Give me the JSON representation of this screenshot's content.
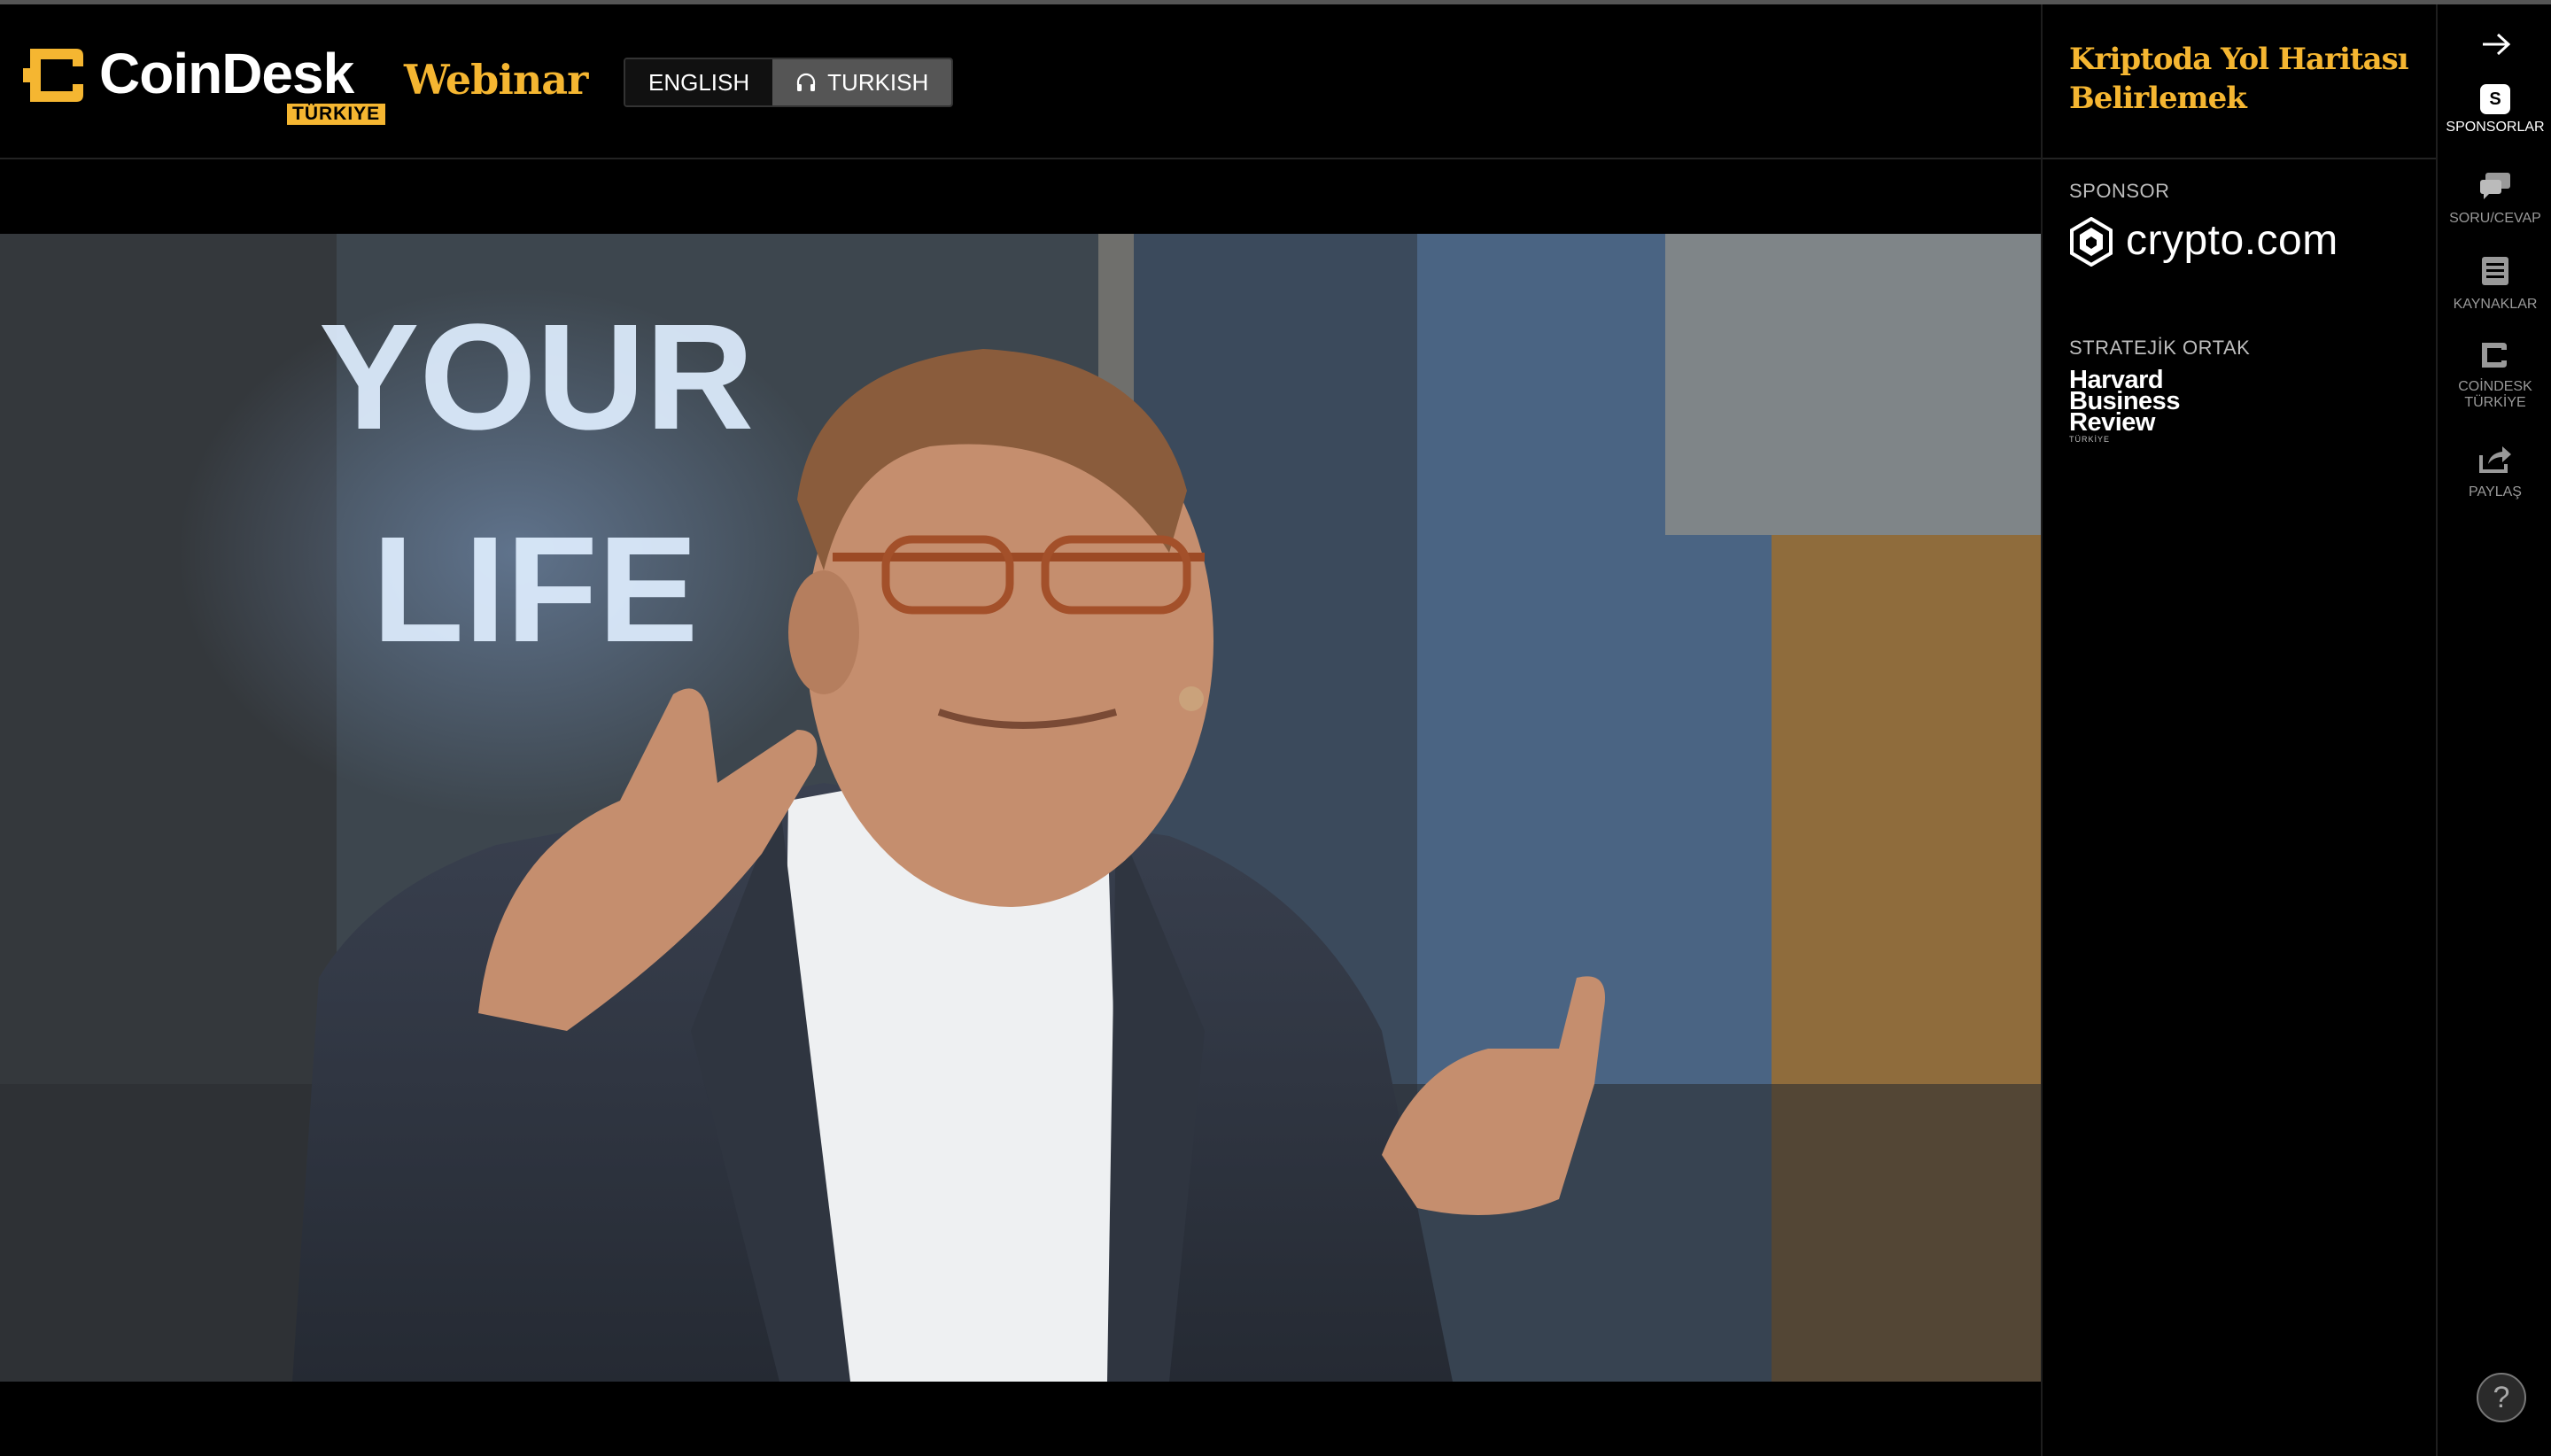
{
  "header": {
    "brand_name": "CoinDesk",
    "brand_sub": "TÜRKIYE",
    "product": "Webinar",
    "languages": [
      {
        "label": "ENGLISH",
        "selected": false
      },
      {
        "label": "TURKISH",
        "selected": true
      }
    ]
  },
  "video": {
    "sign_text_line1": "YOUR",
    "sign_text_line2": "LIFE"
  },
  "panel": {
    "event_title": "Kriptoda Yol Haritası Belirlemek",
    "sponsor_label": "SPONSOR",
    "sponsor_name": "crypto.com",
    "partner_label": "STRATEJİK ORTAK",
    "partner_lines": [
      "Harvard",
      "Business",
      "Review"
    ],
    "partner_sub": "TÜRKİYE"
  },
  "rail": {
    "items": [
      {
        "label": "SPONSORLAR",
        "icon": "sponsors-icon",
        "active": true
      },
      {
        "label": "SORU/CEVAP",
        "icon": "chat-icon",
        "active": false
      },
      {
        "label": "KAYNAKLAR",
        "icon": "resources-icon",
        "active": false
      },
      {
        "label": "COİNDESK TÜRKİYE",
        "icon": "coindesk-icon",
        "active": false
      },
      {
        "label": "PAYLAŞ",
        "icon": "share-icon",
        "active": false
      }
    ],
    "sponsor_badge": "S",
    "help": "?"
  },
  "colors": {
    "accent": "#f5b631",
    "background": "#000000",
    "button_selected": "#555555"
  }
}
